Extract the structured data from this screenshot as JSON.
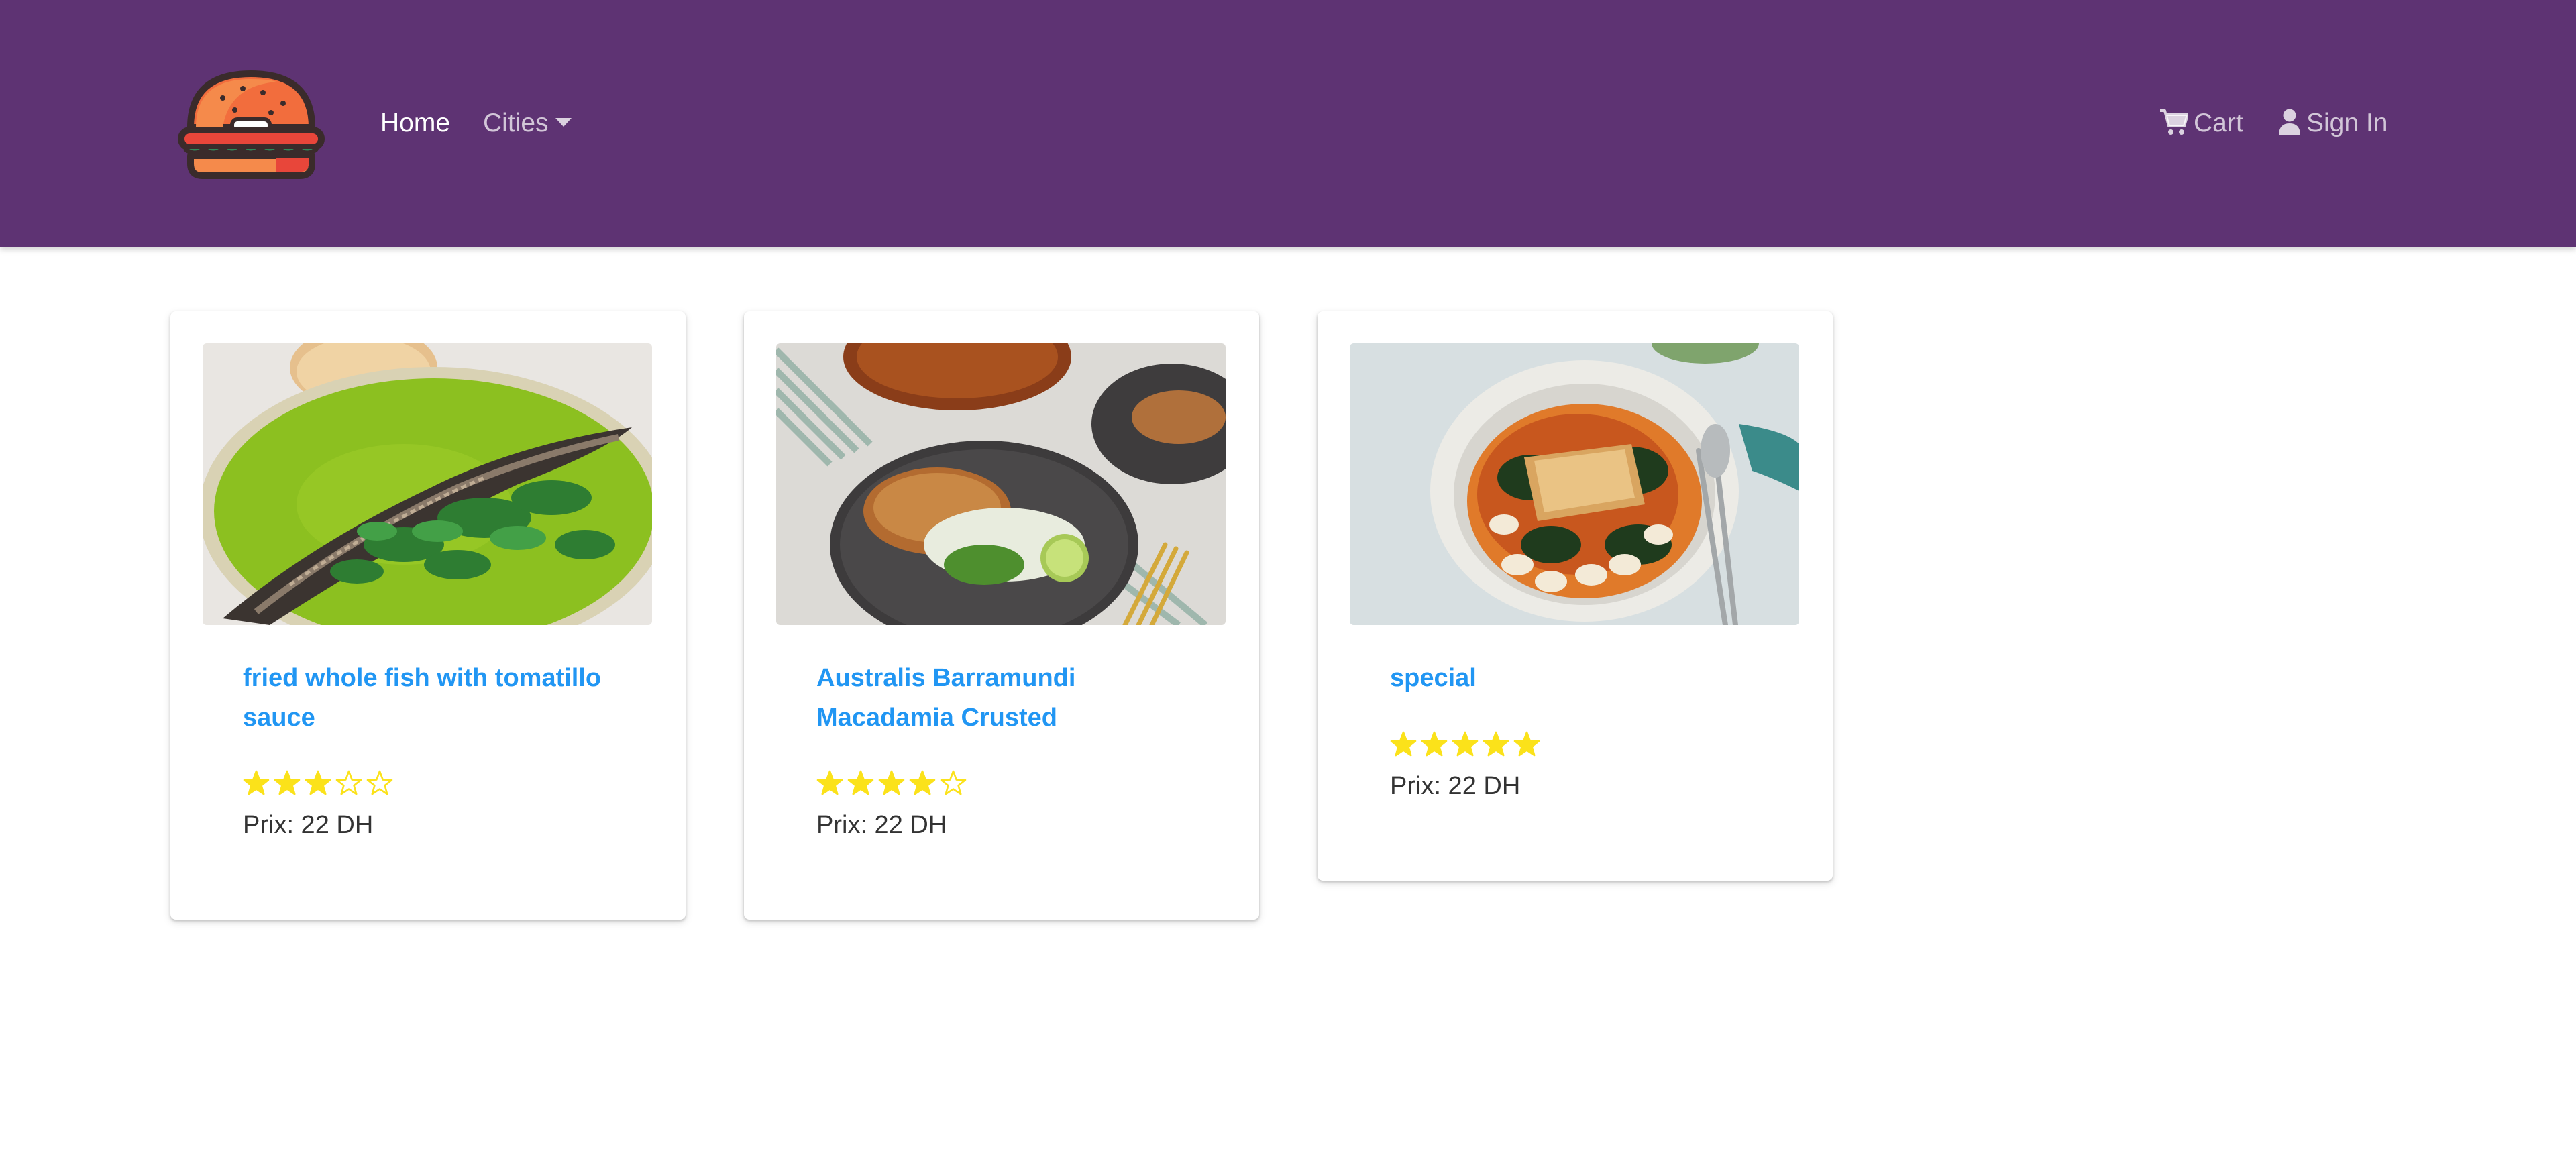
{
  "navbar": {
    "background": "#5e3373",
    "logo_icon": "burger-logo",
    "links": {
      "home": "Home",
      "cities": "Cities",
      "cart": "Cart",
      "signin": "Sign In"
    }
  },
  "colors": {
    "title_link": "#2196f3",
    "star": "#fbe21a",
    "price_text": "#333333"
  },
  "products": [
    {
      "title": "fried whole fish with tomatillo sauce",
      "rating": 3,
      "rating_max": 5,
      "price": "Prix: 22 DH"
    },
    {
      "title": "Australis Barramundi Macadamia Crusted",
      "rating": 4,
      "rating_max": 5,
      "price": "Prix: 22 DH"
    },
    {
      "title": "special",
      "rating": 5,
      "rating_max": 5,
      "price": "Prix: 22 DH"
    }
  ]
}
